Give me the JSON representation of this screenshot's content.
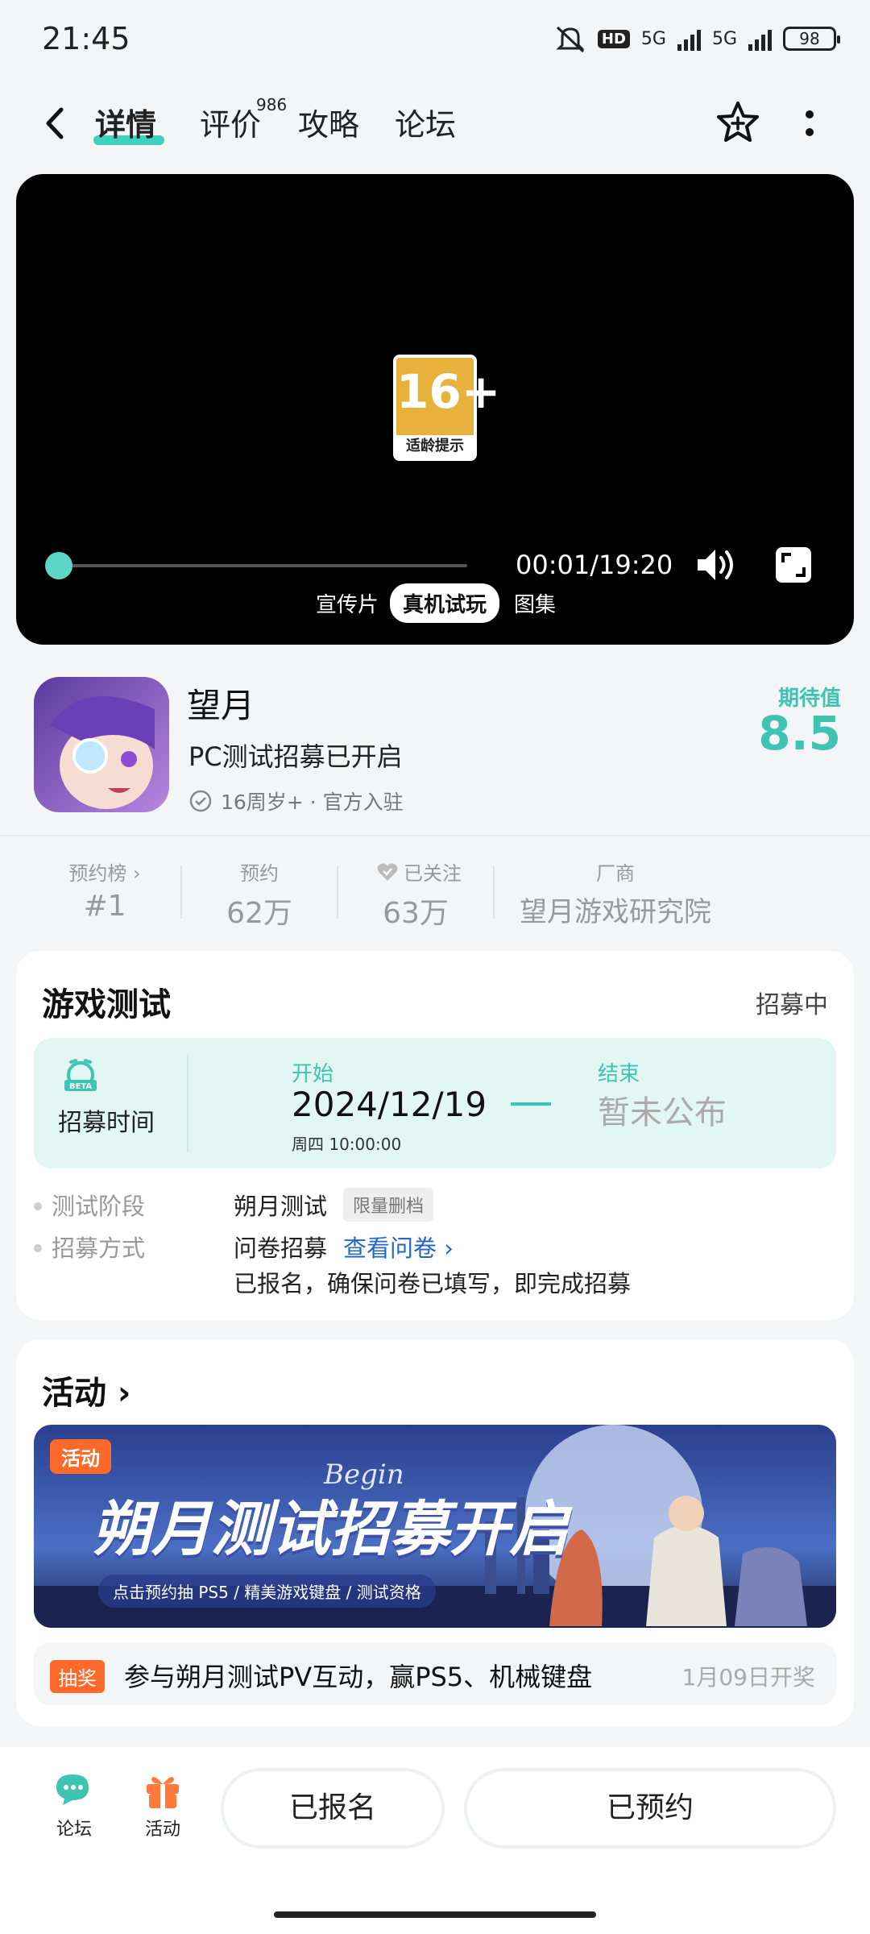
{
  "status": {
    "time": "21:45",
    "network1": "5G",
    "network2": "5G",
    "hd": "HD",
    "battery": "98"
  },
  "nav": {
    "tabs": [
      {
        "label": "详情"
      },
      {
        "label": "评价"
      },
      {
        "label": "攻略"
      },
      {
        "label": "论坛"
      }
    ],
    "review_count": "986"
  },
  "video": {
    "age_rating": "16+",
    "age_rating_label": "适龄提示",
    "time": "00:01/19:20",
    "progress": 0.001,
    "tabs": [
      {
        "label": "宣传片"
      },
      {
        "label": "真机试玩"
      },
      {
        "label": "图集"
      }
    ],
    "active_tab": "真机试玩"
  },
  "game": {
    "title": "望月",
    "subtitle": "PC测试招募已开启",
    "meta": "16周岁+ · 官方入驻",
    "expect_label": "期待值",
    "expect_value": "8.5"
  },
  "stats": [
    {
      "label": "预约榜 ›",
      "value": "#1"
    },
    {
      "label": "预约",
      "value": "62万"
    },
    {
      "label": "已关注",
      "value": "63万"
    },
    {
      "label": "厂商",
      "value": "望月游戏研究院"
    }
  ],
  "test": {
    "title": "游戏测试",
    "status": "招募中",
    "recruit_label": "招募时间",
    "beta": "BETA",
    "start_label": "开始",
    "start_date": "2024/12/19",
    "start_time": "周四  10:00:00",
    "end_label": "结束",
    "end_value": "暂未公布",
    "rows": [
      {
        "key": "测试阶段",
        "value": "朔月测试",
        "tag": "限量删档"
      },
      {
        "key": "招募方式",
        "value": "问卷招募",
        "link": "查看问卷 ›",
        "note": "已报名，确保问卷已填写，即完成招募"
      }
    ]
  },
  "activity": {
    "title": "活动 ›",
    "banner_tag": "活动",
    "banner_title": "朔月测试招募开启",
    "banner_begin": "Begin",
    "banner_sub": "点击预约抽 PS5 / 精美游戏键盘 / 测试资格",
    "lottery_tag": "抽奖",
    "lottery_text": "参与朔月测试PV互动，赢PS5、机械键盘",
    "lottery_date": "1月09日开奖"
  },
  "bottom": {
    "forum_label": "论坛",
    "activity_label": "活动",
    "signup_label": "已报名",
    "reserve_label": "已预约"
  },
  "colors": {
    "accent": "#3fc4b2",
    "orange": "#ff6a2b",
    "link": "#2767c4"
  }
}
